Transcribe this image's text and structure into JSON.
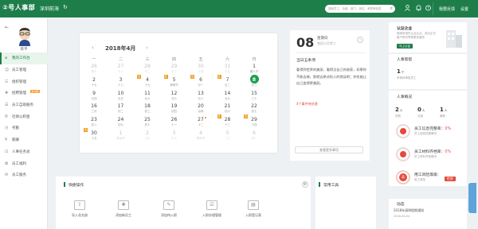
{
  "topbar": {
    "logo": "②号人事部",
    "company": "深圳前海",
    "search_placeholder": "搜索员工、功能、部门、岗位、考勤等信息",
    "links": [
      "我要反馈",
      "设置"
    ]
  },
  "sidebar": {
    "username": "蒋平",
    "items": [
      {
        "label": "我的工作台",
        "icon": "home-icon",
        "active": true
      },
      {
        "label": "员工管理",
        "icon": "person-icon"
      },
      {
        "label": "组织管理",
        "icon": "org-icon"
      },
      {
        "label": "招聘管理",
        "icon": "recruit-icon",
        "badge": "新功能"
      },
      {
        "label": "员工自助服务",
        "icon": "self-service-icon"
      },
      {
        "label": "社保公积金",
        "icon": "shield-icon"
      },
      {
        "label": "考勤",
        "icon": "clock-icon"
      },
      {
        "label": "薪酬",
        "icon": "money-icon"
      },
      {
        "label": "人事任务总",
        "icon": "task-icon"
      },
      {
        "label": "员工福利",
        "icon": "gift-icon"
      },
      {
        "label": "员工服务",
        "icon": "service-icon"
      }
    ]
  },
  "calendar": {
    "title": "2018年4月",
    "weekdays": [
      "一",
      "二",
      "三",
      "四",
      "五",
      "六",
      "日"
    ],
    "weeks": [
      [
        {
          "d": "26",
          "l": "初十",
          "m": true
        },
        {
          "d": "27",
          "l": "十一",
          "m": true
        },
        {
          "d": "28",
          "l": "十二",
          "m": true
        },
        {
          "d": "29",
          "l": "十三",
          "m": true
        },
        {
          "d": "30",
          "l": "十四",
          "m": true
        },
        {
          "d": "31",
          "l": "十五",
          "m": true
        },
        {
          "d": "1",
          "l": "愚人节"
        }
      ],
      [
        {
          "d": "2",
          "l": "十七"
        },
        {
          "d": "3",
          "l": "十八"
        },
        {
          "d": "4",
          "l": "十九",
          "t": true
        },
        {
          "d": "5",
          "l": "清明节",
          "t": true
        },
        {
          "d": "6",
          "l": "廿一",
          "t": true
        },
        {
          "d": "7",
          "l": "廿二",
          "t": true
        },
        {
          "d": "8",
          "l": "廿三",
          "today": true
        }
      ],
      [
        {
          "d": "9",
          "l": "廿四"
        },
        {
          "d": "10",
          "l": "廿五"
        },
        {
          "d": "11",
          "l": "廿六"
        },
        {
          "d": "12",
          "l": "廿七"
        },
        {
          "d": "13",
          "l": "廿八"
        },
        {
          "d": "14",
          "l": "廿九"
        },
        {
          "d": "15",
          "l": "三十"
        }
      ],
      [
        {
          "d": "16",
          "l": "三月"
        },
        {
          "d": "17",
          "l": "初二"
        },
        {
          "d": "18",
          "l": "初三"
        },
        {
          "d": "19",
          "l": "初四"
        },
        {
          "d": "20",
          "l": "谷雨"
        },
        {
          "d": "21",
          "l": "初六"
        },
        {
          "d": "22",
          "l": "初七"
        }
      ],
      [
        {
          "d": "23",
          "l": "初八"
        },
        {
          "d": "24",
          "l": "初九"
        },
        {
          "d": "25",
          "l": "初十"
        },
        {
          "d": "26",
          "l": "十一"
        },
        {
          "d": "27",
          "l": "十二",
          "dot": true
        },
        {
          "d": "28",
          "l": "十三",
          "t": true
        },
        {
          "d": "29",
          "l": "十四",
          "t": true
        }
      ],
      [
        {
          "d": "30",
          "l": "十五",
          "t": true
        },
        {
          "d": "1",
          "l": "劳动节",
          "m": true
        },
        {
          "d": "2",
          "l": "十七",
          "m": true
        },
        {
          "d": "3",
          "l": "十八",
          "m": true
        },
        {
          "d": "4",
          "l": "青年节",
          "m": true
        },
        {
          "d": "5",
          "l": "二十",
          "m": true
        },
        {
          "d": "6",
          "l": "廿一",
          "m": true
        }
      ]
    ],
    "tag_label": "班"
  },
  "day_detail": {
    "day": "08",
    "weekday": "星期日",
    "lunar": "农历二月廿三",
    "msg_title": "当日五条项",
    "msg_text": "看得到世界的美丽，看得见自己的收获，如果你不能去做，那就去原谅别人的错误吧；你也能让自己变得更美丽。",
    "msg_link": "4个事件待处理",
    "more_button": "查看更多事项"
  },
  "quick_actions": {
    "title": "快捷操作",
    "items": [
      "导入花名册",
      "添加新员工",
      "添加待入职",
      "入职办理管理",
      "入职登记表"
    ]
  },
  "tools": {
    "title": "常用工具"
  },
  "right": {
    "cert": {
      "title": "认证企业",
      "desc": "使用前请先认证企业，成为正式客户即可享受更多服务",
      "button": "马上认证"
    },
    "assistant": {
      "title": "人事帮帮",
      "stats": [
        {
          "value": "1",
          "unit": "个",
          "label": "申请待审批员工"
        }
      ]
    },
    "overview": {
      "title": "人事概况",
      "stats": [
        {
          "value": "2",
          "unit": "人",
          "label": "在职"
        },
        {
          "value": "0",
          "unit": "人",
          "label": "试用"
        },
        {
          "value": "1",
          "unit": "人",
          "label": "离职"
        }
      ],
      "rates": [
        {
          "label": "员工信息完整率：",
          "value": "0%",
          "sub": "员工信息完整情况"
        },
        {
          "label": "员工材料齐档率：",
          "value": "0%",
          "sub": "员工材料齐档情况"
        }
      ],
      "risk_title": "用工风险等级：",
      "risk_value": "高",
      "risk_sub": "用工风险",
      "risk_button": "检测"
    },
    "news": {
      "title": "动态",
      "items": [
        {
          "text": "2018年清明假期通知",
          "date": "2018-04-04"
        }
      ]
    }
  },
  "colors": {
    "primary": "#1e7e4a",
    "accent": "#f39a1f",
    "danger": "#e34a3a"
  }
}
